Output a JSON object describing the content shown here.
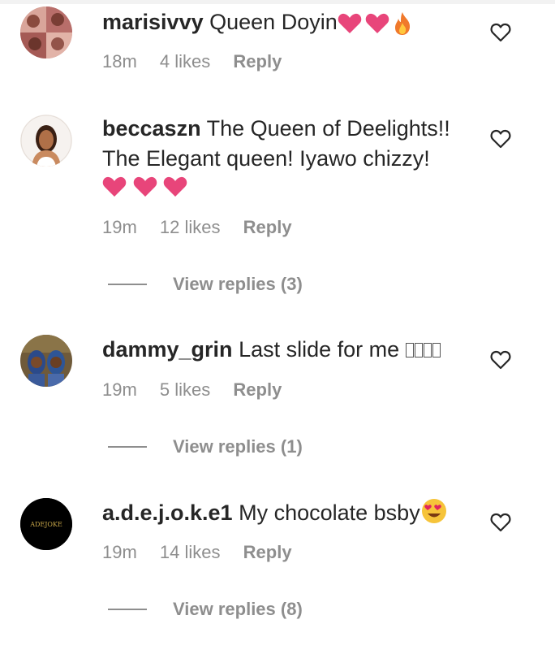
{
  "comments": [
    {
      "username": "marisivvy",
      "text": "Queen Doyin",
      "emojis": [
        "heart",
        "heart",
        "fire"
      ],
      "time": "18m",
      "likes": "4 likes",
      "reply_label": "Reply",
      "like_icon": "heart-outline-icon"
    },
    {
      "username": "beccaszn",
      "text": "The Queen of Deelights!! The Elegant queen! Iyawo chizzy!",
      "emojis": [
        "heart",
        "heart",
        "heart"
      ],
      "time": "19m",
      "likes": "12 likes",
      "reply_label": "Reply",
      "view_replies": "View replies (3)",
      "like_icon": "heart-outline-icon"
    },
    {
      "username": "dammy_grin",
      "text": "Last slide for me",
      "emojis": [
        "missing-glyph",
        "missing-glyph",
        "missing-glyph",
        "missing-glyph"
      ],
      "time": "19m",
      "likes": "5 likes",
      "reply_label": "Reply",
      "view_replies": "View replies (1)",
      "like_icon": "heart-outline-icon"
    },
    {
      "username": "a.d.e.j.o.k.e1",
      "text": "My chocolate bsby",
      "emojis": [
        "heart-eyes-face"
      ],
      "time": "19m",
      "likes": "14 likes",
      "reply_label": "Reply",
      "view_replies": "View replies (8)",
      "like_icon": "heart-outline-icon",
      "avatar_text": "ADEJOKE"
    }
  ],
  "colors": {
    "text": "#262626",
    "meta": "#8e8e8e",
    "heart_emoji": "#e8457a"
  }
}
